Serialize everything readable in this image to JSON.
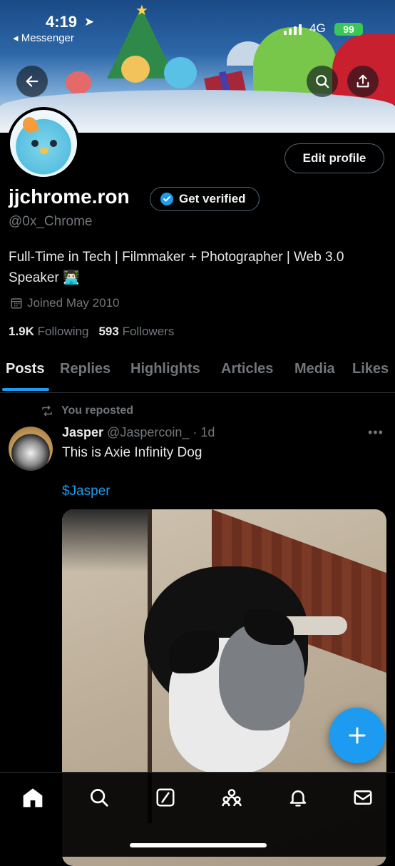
{
  "status_bar": {
    "time": "4:19",
    "back_app": "◂ Messenger",
    "network": "4G",
    "battery": "99"
  },
  "profile": {
    "display_name": "jjchrome.ron",
    "handle": "@0x_Chrome",
    "bio": "Full-Time in Tech | Filmmaker + Photographer | Web 3.0 Speaker 👨🏻‍💻",
    "joined": "Joined May 2010",
    "following_count": "1.9K",
    "following_label": "Following",
    "followers_count": "593",
    "followers_label": "Followers",
    "edit_profile_label": "Edit profile",
    "get_verified_label": "Get verified"
  },
  "tabs": [
    "Posts",
    "Replies",
    "Highlights",
    "Articles",
    "Media",
    "Likes"
  ],
  "active_tab": "Posts",
  "post": {
    "repost_label": "You reposted",
    "author_name": "Jasper",
    "author_handle": "@Jaspercoin_",
    "time": "· 1d",
    "text": "This is Axie Infinity Dog",
    "cashtag": "$Jasper"
  },
  "colors": {
    "accent": "#1d9bf0",
    "background": "#000000",
    "secondary_text": "#71767b"
  },
  "icons": {
    "top_bar": [
      "back-arrow-icon",
      "search-icon",
      "share-icon"
    ],
    "bottom_nav": [
      "home-icon",
      "search-icon",
      "grok-icon",
      "communities-icon",
      "notifications-icon",
      "messages-icon"
    ],
    "fab": "plus-icon"
  }
}
